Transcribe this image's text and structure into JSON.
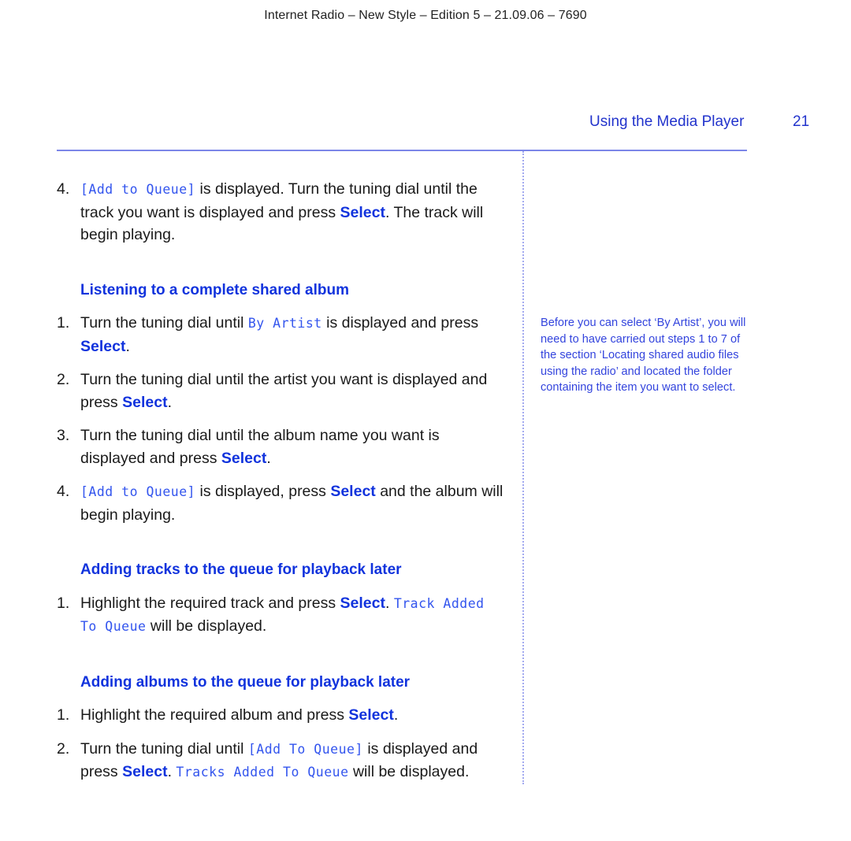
{
  "running_head": "Internet Radio – New Style – Edition 5 – 21.09.06 – 7690",
  "header": {
    "section_title": "Using the Media Player",
    "page_number": "21"
  },
  "colors": {
    "accent_blue": "#1133dd",
    "rule_blue": "#7b86e8",
    "body_text": "#1a1a1a"
  },
  "intro_step": {
    "number": "4.",
    "lcd": "[Add to Queue]",
    "text_a": " is displayed. Turn the tuning dial until the track you want is displayed and press ",
    "key": "Select",
    "text_b": ".  The track will begin playing."
  },
  "sections": [
    {
      "heading": "Listening to a complete shared album",
      "steps": [
        {
          "number": "1.",
          "text_a": "Turn the tuning dial until ",
          "lcd": "By Artist",
          "text_b": " is displayed and press ",
          "key": "Select",
          "text_c": "."
        },
        {
          "number": "2.",
          "text_a": "Turn the tuning dial until the artist you want is displayed and press ",
          "key": "Select",
          "text_b": "."
        },
        {
          "number": "3.",
          "text_a": "Turn the tuning dial until the album name you want is displayed and press ",
          "key": "Select",
          "text_b": "."
        },
        {
          "number": "4.",
          "lcd": "[Add to Queue]",
          "text_a": " is displayed, press ",
          "key": "Select",
          "text_b": " and the album will begin playing."
        }
      ]
    },
    {
      "heading": "Adding tracks to the queue for playback later",
      "steps": [
        {
          "number": "1.",
          "text_a": "Highlight the required track and press ",
          "key": "Select",
          "text_b": ". ",
          "lcd": "Track Added To Queue",
          "text_c": " will be displayed."
        }
      ]
    },
    {
      "heading": "Adding albums to the queue for playback later",
      "steps": [
        {
          "number": "1.",
          "text_a": "Highlight the required album and press ",
          "key": "Select",
          "text_b": "."
        },
        {
          "number": "2.",
          "text_a": "Turn the tuning dial until ",
          "lcd": "[Add To Queue]",
          "text_b": " is displayed and press ",
          "key": "Select",
          "text_c": ". ",
          "lcd2": "Tracks Added To Queue",
          "text_d": " will be displayed."
        }
      ]
    }
  ],
  "sidenote": "Before you can select ‘By Artist’, you will need to have carried out steps 1 to 7 of the section ‘Locating shared audio files using the radio’ and located the folder containing the item you want to select."
}
